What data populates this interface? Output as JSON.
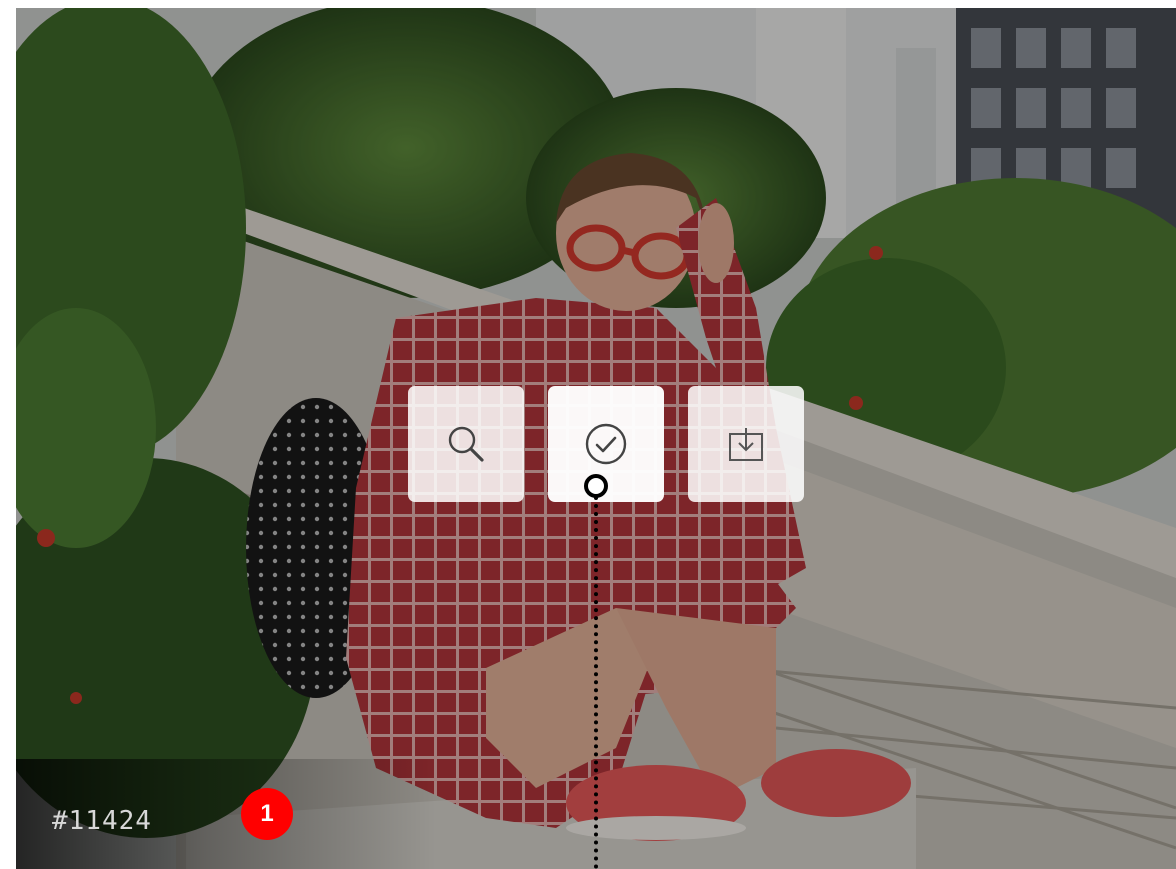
{
  "photo": {
    "image_id_label": "#11424",
    "overlay_color": "#000000"
  },
  "actions": [
    {
      "name": "zoom",
      "icon": "search-icon"
    },
    {
      "name": "select",
      "icon": "check-circle-icon"
    },
    {
      "name": "download",
      "icon": "download-icon"
    }
  ],
  "annotation": {
    "step_number": "1",
    "badge_color": "#ff0000"
  }
}
